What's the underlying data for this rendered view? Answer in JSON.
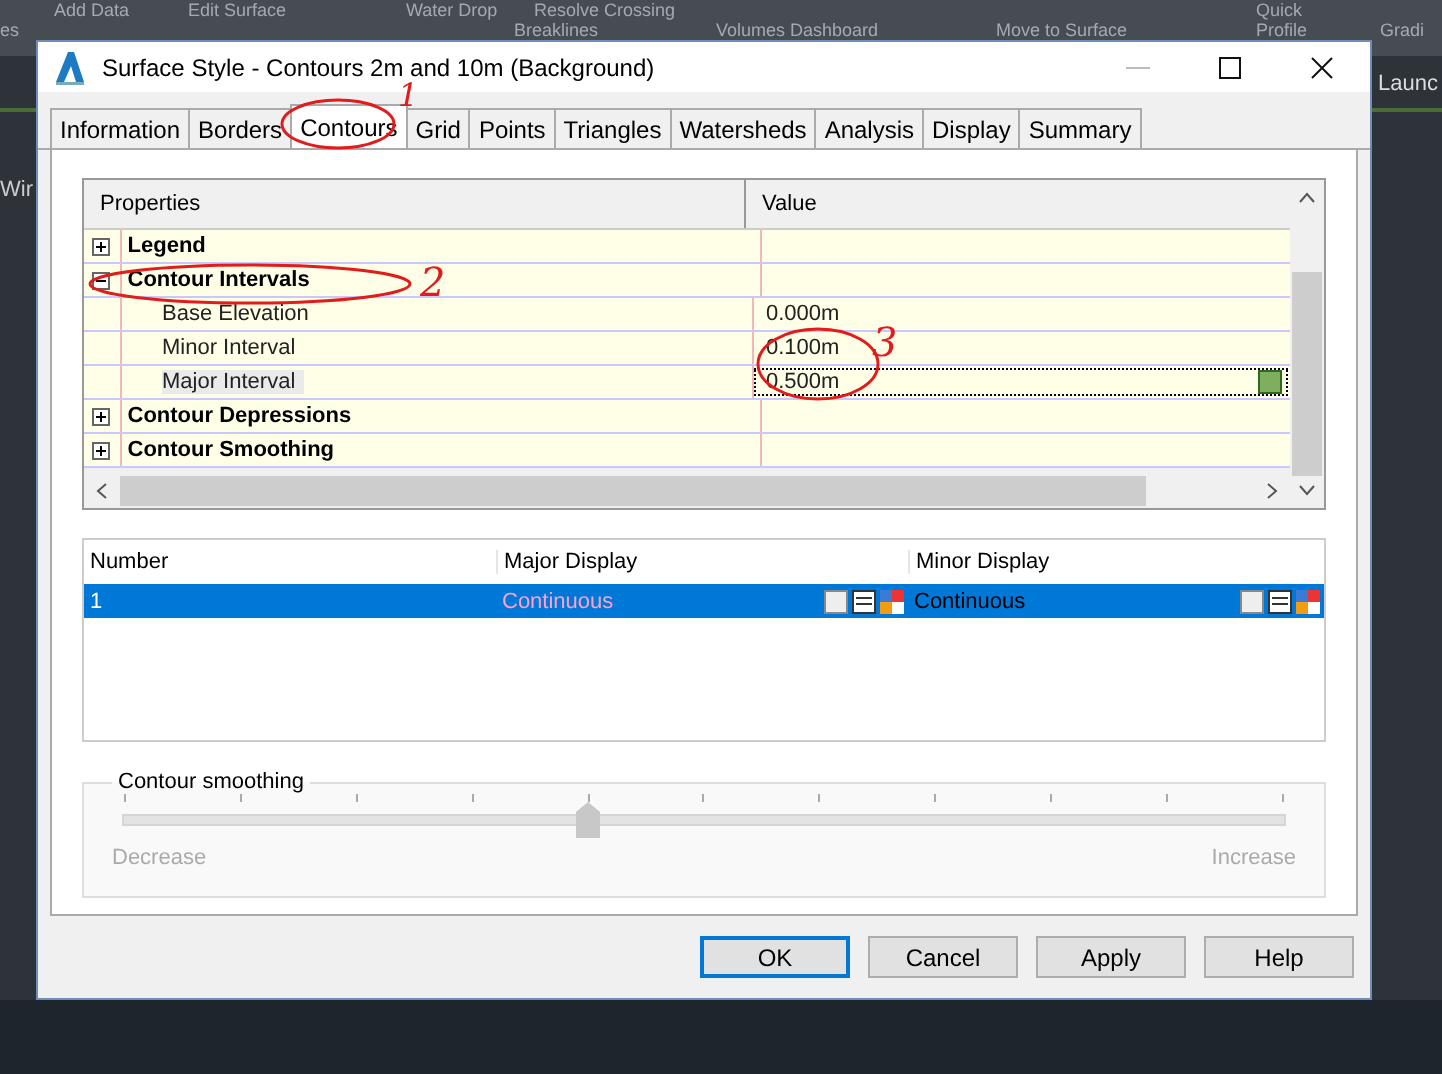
{
  "background_app": {
    "ribbon_top": [
      "Add Data",
      "Edit Surface",
      "Water Drop",
      "Resolve Crossing",
      "Quick"
    ],
    "ribbon_bottom": [
      "es",
      "Breaklines",
      "Volumes Dashboard",
      "Move to Surface",
      "Profile",
      "Gradi"
    ],
    "right_label": "Launc",
    "left_label": "Wir"
  },
  "window": {
    "title": "Surface Style - Contours 2m and 10m (Background)"
  },
  "tabs": [
    {
      "label": "Information",
      "selected": false
    },
    {
      "label": "Borders",
      "selected": false
    },
    {
      "label": "Contours",
      "selected": true
    },
    {
      "label": "Grid",
      "selected": false
    },
    {
      "label": "Points",
      "selected": false
    },
    {
      "label": "Triangles",
      "selected": false
    },
    {
      "label": "Watersheds",
      "selected": false
    },
    {
      "label": "Analysis",
      "selected": false
    },
    {
      "label": "Display",
      "selected": false
    },
    {
      "label": "Summary",
      "selected": false
    }
  ],
  "property_grid": {
    "columns": [
      "Properties",
      "Value"
    ],
    "categories": [
      {
        "name": "Legend",
        "expanded": false
      },
      {
        "name": "Contour Intervals",
        "expanded": true,
        "children": [
          {
            "name": "Base Elevation",
            "value": "0.000m",
            "selected": false
          },
          {
            "name": "Minor Interval",
            "value": "0.100m",
            "selected": false
          },
          {
            "name": "Major Interval",
            "value": "0.500m",
            "selected": true
          }
        ]
      },
      {
        "name": "Contour Depressions",
        "expanded": false
      },
      {
        "name": "Contour Smoothing",
        "expanded": false
      }
    ]
  },
  "display_list": {
    "columns": [
      "Number",
      "Major Display",
      "Minor Display"
    ],
    "rows": [
      {
        "number": "1",
        "major": "Continuous",
        "minor": "Continuous",
        "selected": true
      }
    ]
  },
  "smoothing": {
    "title": "Contour smoothing",
    "level": 0.4,
    "min_label": "Decrease",
    "max_label": "Increase"
  },
  "buttons": [
    {
      "label": "OK",
      "default": true
    },
    {
      "label": "Cancel",
      "default": false
    },
    {
      "label": "Apply",
      "default": false
    },
    {
      "label": "Help",
      "default": false
    }
  ],
  "annotations": [
    "1",
    "2",
    "3"
  ]
}
